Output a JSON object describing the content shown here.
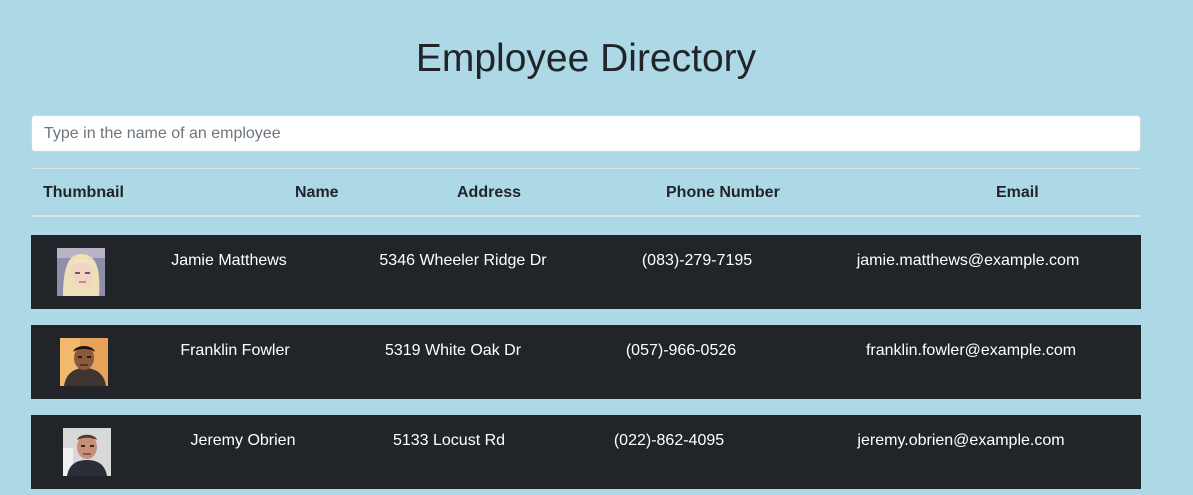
{
  "header": {
    "title": "Employee Directory"
  },
  "search": {
    "placeholder": "Type in the name of an employee",
    "value": ""
  },
  "table": {
    "columns": [
      "Thumbnail",
      "Name",
      "Address",
      "Phone Number",
      "Email"
    ],
    "rows": [
      {
        "thumbnail": "employee-photo",
        "name": "Jamie Matthews",
        "address": "5346 Wheeler Ridge Dr",
        "phone": "(083)-279-7195",
        "email": "jamie.matthews@example.com"
      },
      {
        "thumbnail": "employee-photo",
        "name": "Franklin Fowler",
        "address": "5319 White Oak Dr",
        "phone": "(057)-966-0526",
        "email": "franklin.fowler@example.com"
      },
      {
        "thumbnail": "employee-photo",
        "name": "Jeremy Obrien",
        "address": "5133 Locust Rd",
        "phone": "(022)-862-4095",
        "email": "jeremy.obrien@example.com"
      }
    ]
  },
  "colors": {
    "background": "#add8e6",
    "row_background": "#212529",
    "text_light": "#ffffff",
    "text_dark": "#212529"
  }
}
